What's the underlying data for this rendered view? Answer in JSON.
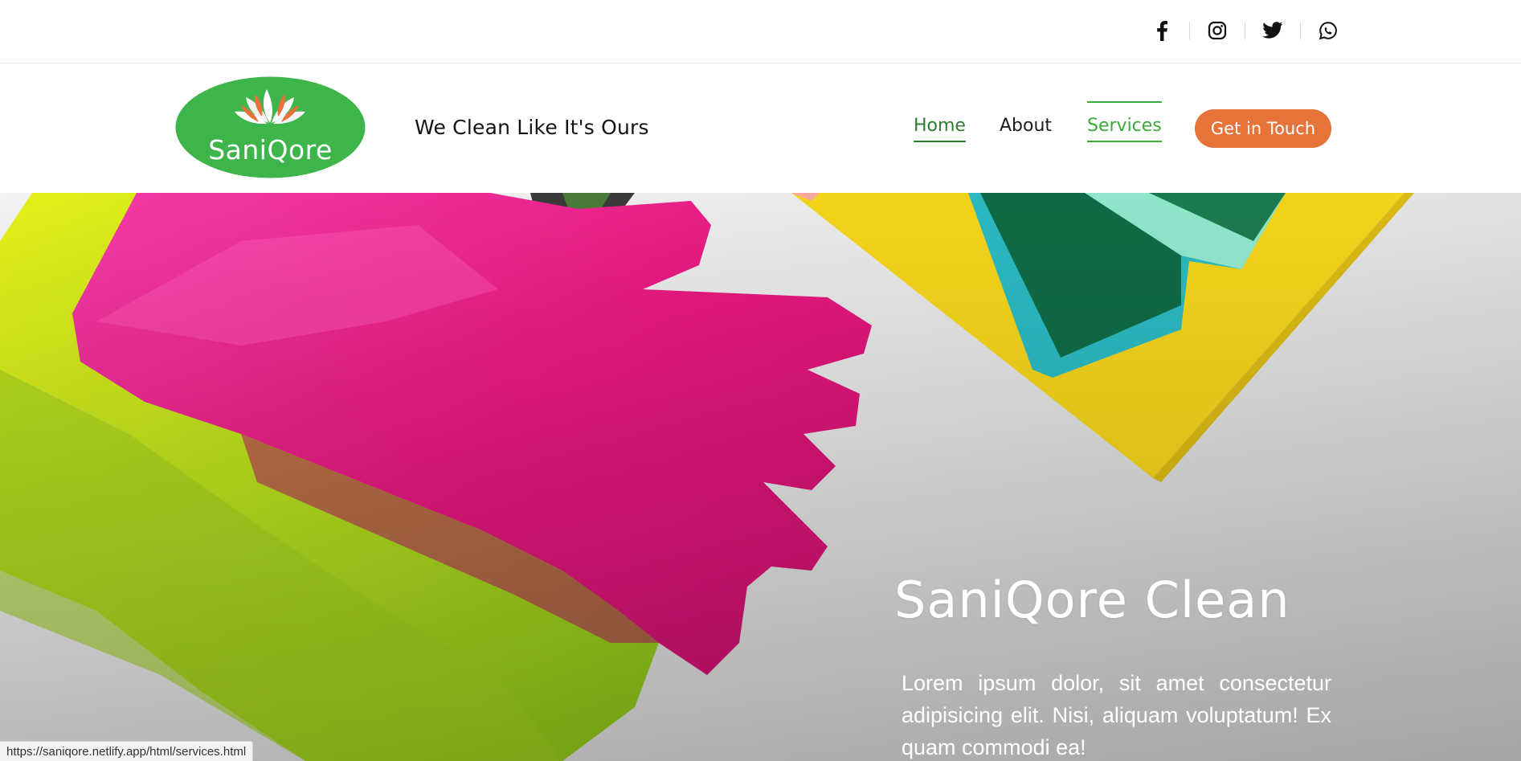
{
  "colors": {
    "brand_green": "#3aaa3a",
    "active_green": "#2f7d2f",
    "cta_orange": "#e5733a"
  },
  "social": {
    "items": [
      {
        "name": "facebook-icon"
      },
      {
        "name": "instagram-icon"
      },
      {
        "name": "twitter-icon"
      },
      {
        "name": "whatsapp-icon"
      }
    ]
  },
  "header": {
    "logo_text": "SaniQore",
    "tagline": "We Clean Like It's Ours"
  },
  "nav": {
    "home": "Home",
    "about": "About",
    "services": "Services",
    "cta": "Get in Touch"
  },
  "hero": {
    "title": "SaniQore Clean",
    "text": "Lorem ipsum dolor, sit amet consectetur adipisicing elit. Nisi, aliquam voluptatum! Ex quam commodi ea!"
  },
  "status": {
    "url": "https://saniqore.netlify.app/html/services.html"
  }
}
